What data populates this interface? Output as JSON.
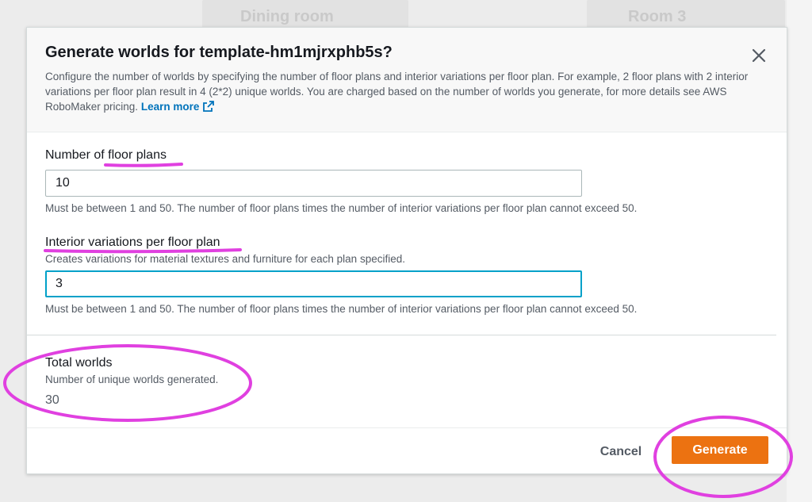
{
  "background": {
    "left_label": "Dining room",
    "right_label": "Room 3"
  },
  "modal": {
    "title": "Generate worlds for template-hm1mjrxphb5s?",
    "description": "Configure the number of worlds by specifying the number of floor plans and interior variations per floor plan. For example, 2 floor plans with 2 interior variations per floor plan result in 4 (2*2) unique worlds. You are charged based on the number of worlds you generate, for more details see AWS RoboMaker pricing.",
    "learn_more": "Learn more",
    "close_icon": "close-icon",
    "external_link_icon": "external-link-icon"
  },
  "floor_plans": {
    "label": "Number of floor plans",
    "value": "10",
    "hint": "Must be between 1 and 50. The number of floor plans times the number of interior variations per floor plan cannot exceed 50."
  },
  "interior_variations": {
    "label": "Interior variations per floor plan",
    "description": "Creates variations for material textures and furniture for each plan specified.",
    "value": "3",
    "hint": "Must be between 1 and 50. The number of floor plans times the number of interior variations per floor plan cannot exceed 50."
  },
  "total": {
    "label": "Total worlds",
    "description": "Number of unique worlds generated.",
    "value": "30"
  },
  "footer": {
    "cancel": "Cancel",
    "generate": "Generate"
  },
  "colors": {
    "primary_button": "#ec7211",
    "link": "#0073bb",
    "focus_border": "#00a1c9",
    "annotation": "#e040e0"
  }
}
